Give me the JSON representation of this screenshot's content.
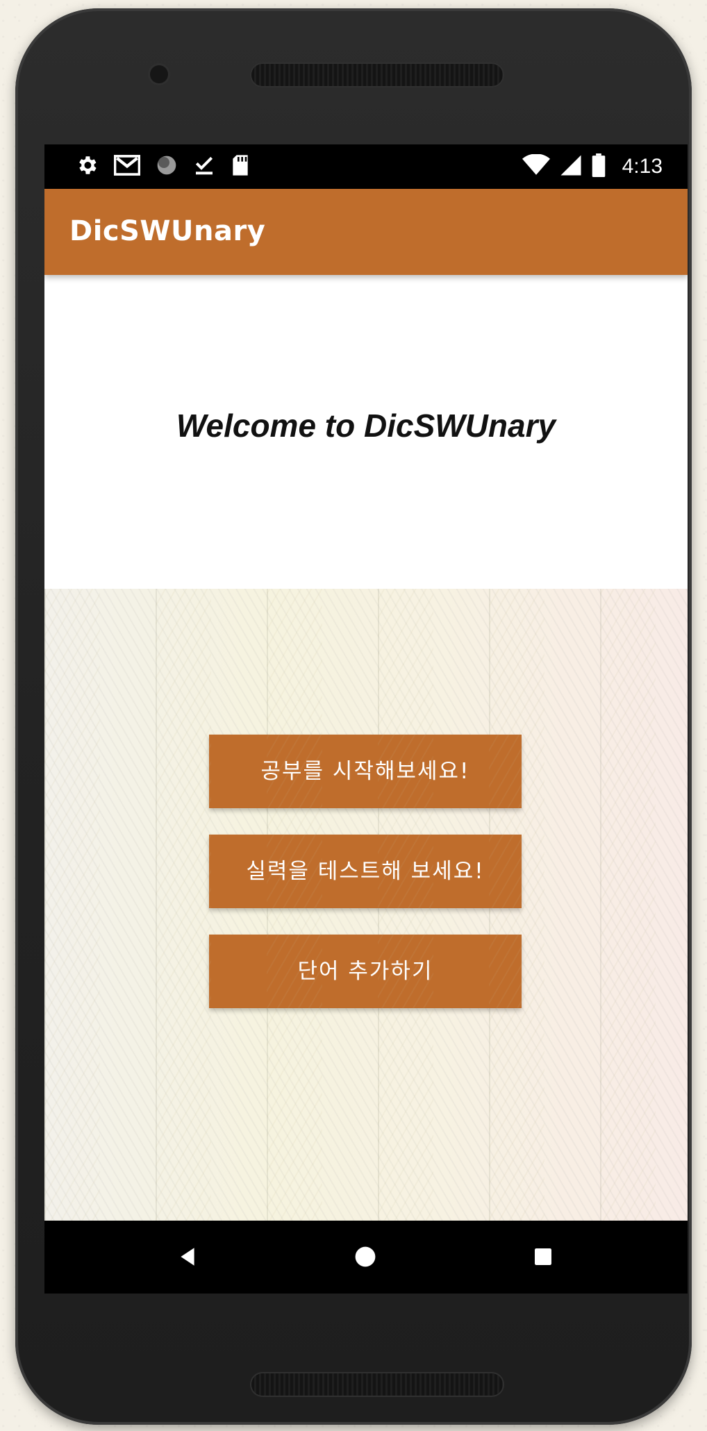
{
  "status_bar": {
    "time": "4:13",
    "left_icons": [
      "settings-icon",
      "gmail-icon",
      "circle-icon",
      "download-done-icon",
      "sd-card-icon"
    ],
    "right_icons": [
      "wifi-icon",
      "signal-icon",
      "battery-icon"
    ]
  },
  "app_bar": {
    "title": "DicSWUnary"
  },
  "main": {
    "welcome": "Welcome to DicSWUnary",
    "buttons": [
      {
        "label": "공부를 시작해보세요!"
      },
      {
        "label": "실력을 테스트해 보세요!"
      },
      {
        "label": "단어 추가하기"
      }
    ]
  },
  "nav_bar": {
    "icons": [
      "back-icon",
      "home-icon",
      "recents-icon"
    ]
  },
  "colors": {
    "accent": "#bf6d2c",
    "device": "#262626"
  }
}
